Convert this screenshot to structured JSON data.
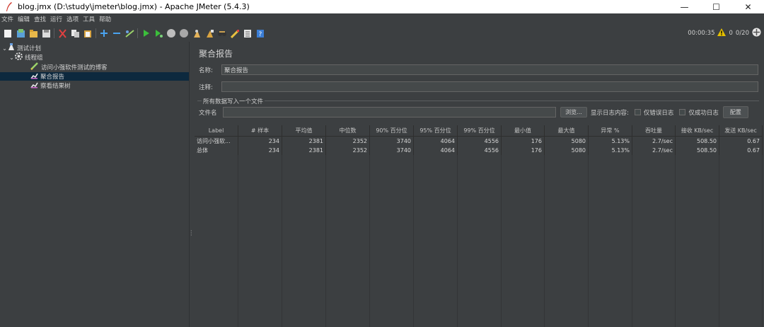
{
  "window": {
    "title": "blog.jmx (D:\\study\\jmeter\\blog.jmx) - Apache JMeter (5.4.3)",
    "minimize": "—",
    "maximize": "☐",
    "close": "✕"
  },
  "menu": [
    "文件",
    "编辑",
    "查找",
    "运行",
    "选项",
    "工具",
    "帮助"
  ],
  "toolbar": {
    "icons": [
      "new-icon",
      "templates-icon",
      "open-icon",
      "save-icon",
      "cut-icon",
      "copy-icon",
      "paste-icon",
      "expand-icon",
      "collapse-icon",
      "toggle-icon",
      "start-icon",
      "start-no-pause-icon",
      "stop-icon",
      "shutdown-icon",
      "clear-icon",
      "clear-all-icon",
      "search-icon",
      "reset-search-icon",
      "function-helper-icon",
      "help-icon"
    ],
    "timer": "00:00:35",
    "warning_count": "0",
    "threads": "0/20"
  },
  "tree": {
    "items": [
      {
        "label": "测试计划",
        "level": 0
      },
      {
        "label": "线程组",
        "level": 1
      },
      {
        "label": "访问小强软件测试的博客",
        "level": 2
      },
      {
        "label": "聚合报告",
        "level": 2,
        "selected": true
      },
      {
        "label": "察看结果树",
        "level": 2
      }
    ]
  },
  "panel": {
    "title": "聚合报告",
    "name_label": "名称:",
    "name_value": "聚合报告",
    "comment_label": "注释:",
    "comment_value": "",
    "group_title": "所有数据写入一个文件",
    "filename_label": "文件名",
    "filename_value": "",
    "browse_button": "浏览...",
    "log_label": "显示日志内容:",
    "errors_only": "仅错误日志",
    "success_only": "仅成功日志",
    "config_button": "配置"
  },
  "table": {
    "headers": [
      "Label",
      "# 样本",
      "平均值",
      "中位数",
      "90% 百分位",
      "95% 百分位",
      "99% 百分位",
      "最小值",
      "最大值",
      "异常 %",
      "吞吐量",
      "接收 KB/sec",
      "发送 KB/sec"
    ],
    "rows": [
      [
        "访问小强软...",
        "234",
        "2381",
        "2352",
        "3740",
        "4064",
        "4556",
        "176",
        "5080",
        "5.13%",
        "2.7/sec",
        "508.50",
        "0.67"
      ],
      [
        "总体",
        "234",
        "2381",
        "2352",
        "3740",
        "4064",
        "4556",
        "176",
        "5080",
        "5.13%",
        "2.7/sec",
        "508.50",
        "0.67"
      ]
    ]
  },
  "colors": {
    "background": "#3c3f41",
    "selection": "#0d293e",
    "warning": "#e5c000"
  }
}
